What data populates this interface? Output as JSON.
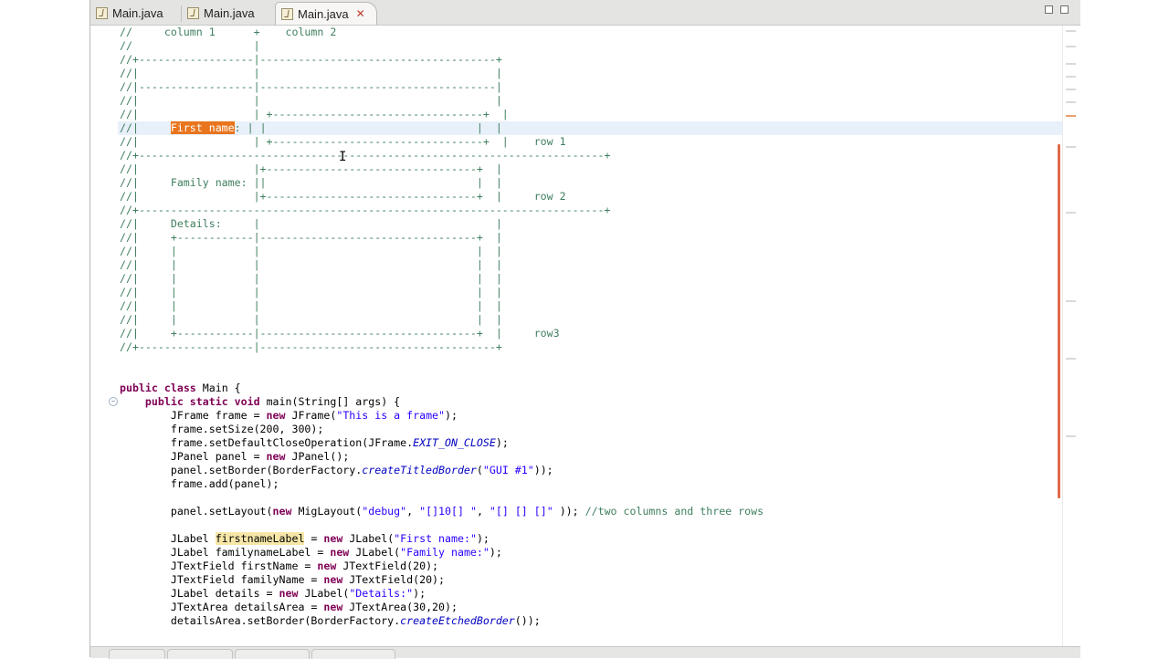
{
  "tabs": [
    {
      "label": "Main.java",
      "active": false
    },
    {
      "label": "Main.java",
      "active": false
    },
    {
      "label": "Main.java",
      "active": true,
      "close_icon": "close-x-icon"
    }
  ],
  "colors": {
    "comment": "#3f7f5f",
    "keyword": "#7f0055",
    "string": "#2a00ff",
    "constant": "#0000c0",
    "selection": "#e9751e",
    "occurrence": "#f6e7a8",
    "current_line": "#e8f0fa"
  },
  "editor": {
    "lines": [
      [
        {
          "c": "cm",
          "t": "//     column 1      +    column 2"
        }
      ],
      [
        {
          "c": "cm",
          "t": "//                   |"
        }
      ],
      [
        {
          "c": "cm",
          "t": "//+------------------|-------------------------------------+"
        }
      ],
      [
        {
          "c": "cm",
          "t": "//|                  |                                     |"
        }
      ],
      [
        {
          "c": "cm",
          "t": "//|------------------|-------------------------------------|"
        }
      ],
      [
        {
          "c": "cm",
          "t": "//|                  |                                     |"
        }
      ],
      [
        {
          "c": "cm",
          "t": "//|                  | +---------------------------------+  |"
        }
      ],
      [
        {
          "c": "cm",
          "t": "//|     "
        },
        {
          "c": "sel",
          "t": "First name"
        },
        {
          "c": "cm",
          "t": ": | |                                 |  |"
        }
      ],
      [
        {
          "c": "cm",
          "t": "//|                  | +---------------------------------+  |    row 1"
        }
      ],
      [
        {
          "c": "cm",
          "t": "//+-------------------------------------------------------------------------+"
        }
      ],
      [
        {
          "c": "cm",
          "t": "//|                  |+---------------------------------+  |"
        }
      ],
      [
        {
          "c": "cm",
          "t": "//|     Family name: ||                                 |  |"
        }
      ],
      [
        {
          "c": "cm",
          "t": "//|                  |+---------------------------------+  |     row 2"
        }
      ],
      [
        {
          "c": "cm",
          "t": "//+-------------------------------------------------------------------------+"
        }
      ],
      [
        {
          "c": "cm",
          "t": "//|     Details:     |                                     |"
        }
      ],
      [
        {
          "c": "cm",
          "t": "//|     +------------|----------------------------------+  |"
        }
      ],
      [
        {
          "c": "cm",
          "t": "//|     |            |                                  |  |"
        }
      ],
      [
        {
          "c": "cm",
          "t": "//|     |            |                                  |  |"
        }
      ],
      [
        {
          "c": "cm",
          "t": "//|     |            |                                  |  |"
        }
      ],
      [
        {
          "c": "cm",
          "t": "//|     |            |                                  |  |"
        }
      ],
      [
        {
          "c": "cm",
          "t": "//|     |            |                                  |  |"
        }
      ],
      [
        {
          "c": "cm",
          "t": "//|     |            |                                  |  |"
        }
      ],
      [
        {
          "c": "cm",
          "t": "//|     +------------|----------------------------------+  |     row3"
        }
      ],
      [
        {
          "c": "cm",
          "t": "//+------------------|-------------------------------------+"
        }
      ],
      [
        {
          "c": "",
          "t": ""
        }
      ],
      [
        {
          "c": "",
          "t": ""
        }
      ],
      [
        {
          "c": "kw",
          "t": "public"
        },
        {
          "c": "",
          "t": " "
        },
        {
          "c": "kw",
          "t": "class"
        },
        {
          "c": "",
          "t": " Main {"
        }
      ],
      [
        {
          "c": "",
          "t": "    "
        },
        {
          "c": "kw",
          "t": "public"
        },
        {
          "c": "",
          "t": " "
        },
        {
          "c": "kw",
          "t": "static"
        },
        {
          "c": "",
          "t": " "
        },
        {
          "c": "kw",
          "t": "void"
        },
        {
          "c": "",
          "t": " main(String[] args) {"
        }
      ],
      [
        {
          "c": "",
          "t": "        JFrame frame = "
        },
        {
          "c": "kw",
          "t": "new"
        },
        {
          "c": "",
          "t": " JFrame("
        },
        {
          "c": "st",
          "t": "\"This is a frame\""
        },
        {
          "c": "",
          "t": ");"
        }
      ],
      [
        {
          "c": "",
          "t": "        frame.setSize(200, 300);"
        }
      ],
      [
        {
          "c": "",
          "t": "        frame.setDefaultCloseOperation(JFrame."
        },
        {
          "c": "it",
          "t": "EXIT_ON_CLOSE"
        },
        {
          "c": "",
          "t": ");"
        }
      ],
      [
        {
          "c": "",
          "t": "        JPanel panel = "
        },
        {
          "c": "kw",
          "t": "new"
        },
        {
          "c": "",
          "t": " JPanel();"
        }
      ],
      [
        {
          "c": "",
          "t": "        panel.setBorder(BorderFactory."
        },
        {
          "c": "it",
          "t": "createTitledBorder"
        },
        {
          "c": "",
          "t": "("
        },
        {
          "c": "st",
          "t": "\"GUI #1\""
        },
        {
          "c": "",
          "t": "));"
        }
      ],
      [
        {
          "c": "",
          "t": "        frame.add(panel);"
        }
      ],
      [
        {
          "c": "",
          "t": ""
        }
      ],
      [
        {
          "c": "",
          "t": "        panel.setLayout("
        },
        {
          "c": "kw",
          "t": "new"
        },
        {
          "c": "",
          "t": " MigLayout("
        },
        {
          "c": "st",
          "t": "\"debug\""
        },
        {
          "c": "",
          "t": ", "
        },
        {
          "c": "st",
          "t": "\"[]10[] \""
        },
        {
          "c": "",
          "t": ", "
        },
        {
          "c": "st",
          "t": "\"[] [] []\""
        },
        {
          "c": "",
          "t": " )); "
        },
        {
          "c": "cm",
          "t": "//two columns and three rows"
        }
      ],
      [
        {
          "c": "",
          "t": ""
        }
      ],
      [
        {
          "c": "",
          "t": "        JLabel "
        },
        {
          "c": "occ",
          "t": "firstnameLabel"
        },
        {
          "c": "",
          "t": " = "
        },
        {
          "c": "kw",
          "t": "new"
        },
        {
          "c": "",
          "t": " JLabel("
        },
        {
          "c": "st",
          "t": "\"First name:\""
        },
        {
          "c": "",
          "t": ");"
        }
      ],
      [
        {
          "c": "",
          "t": "        JLabel familynameLabel = "
        },
        {
          "c": "kw",
          "t": "new"
        },
        {
          "c": "",
          "t": " JLabel("
        },
        {
          "c": "st",
          "t": "\"Family name:\""
        },
        {
          "c": "",
          "t": ");"
        }
      ],
      [
        {
          "c": "",
          "t": "        JTextField firstName = "
        },
        {
          "c": "kw",
          "t": "new"
        },
        {
          "c": "",
          "t": " JTextField(20);"
        }
      ],
      [
        {
          "c": "",
          "t": "        JTextField familyName = "
        },
        {
          "c": "kw",
          "t": "new"
        },
        {
          "c": "",
          "t": " JTextField(20);"
        }
      ],
      [
        {
          "c": "",
          "t": "        JLabel details = "
        },
        {
          "c": "kw",
          "t": "new"
        },
        {
          "c": "",
          "t": " JLabel("
        },
        {
          "c": "st",
          "t": "\"Details:\""
        },
        {
          "c": "",
          "t": ");"
        }
      ],
      [
        {
          "c": "",
          "t": "        JTextArea detailsArea = "
        },
        {
          "c": "kw",
          "t": "new"
        },
        {
          "c": "",
          "t": " JTextArea(30,20);"
        }
      ],
      [
        {
          "c": "",
          "t": "        detailsArea.setBorder(BorderFactory."
        },
        {
          "c": "it",
          "t": "createEtchedBorder"
        },
        {
          "c": "",
          "t": "());"
        }
      ]
    ]
  }
}
